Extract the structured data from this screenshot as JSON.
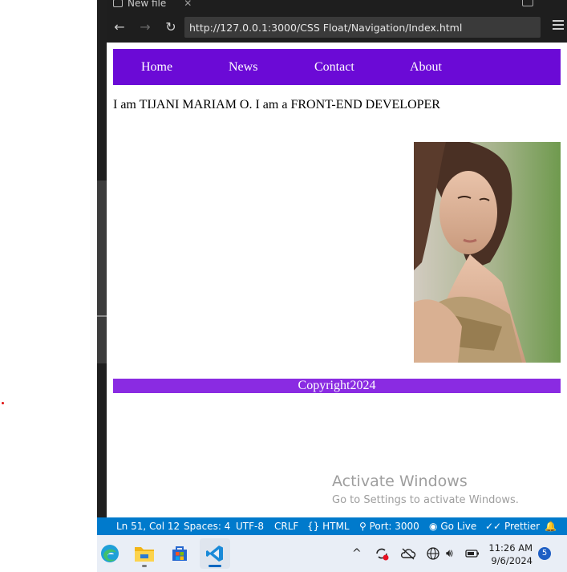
{
  "browser": {
    "tab_title": "New file",
    "url": "http://127.0.0.1:3000/CSS Float/Navigation/Index.html"
  },
  "site": {
    "nav": [
      "Home",
      "News",
      "Contact",
      "About"
    ],
    "intro": "I am TIJANI MARIAM O. I am a FRONT-END DEVELOPER",
    "footer": "Copyright2024",
    "nav_color": "#6b0ad6",
    "footer_color": "#8a2be2"
  },
  "watermark": {
    "title": "Activate Windows",
    "subtitle": "Go to Settings to activate Windows."
  },
  "statusbar": {
    "position": "Ln 51, Col 12",
    "spaces": "Spaces: 4",
    "encoding": "UTF-8",
    "eol": "CRLF",
    "language": "HTML",
    "port": "Port: 3000",
    "golive": "Go Live",
    "prettier": "Prettier",
    "color": "#007acc"
  },
  "taskbar": {
    "apps": [
      "edge-icon",
      "file-explorer-icon",
      "microsoft-store-icon",
      "vscode-icon"
    ],
    "time": "11:26 AM",
    "date": "9/6/2024",
    "notifications": "5"
  }
}
